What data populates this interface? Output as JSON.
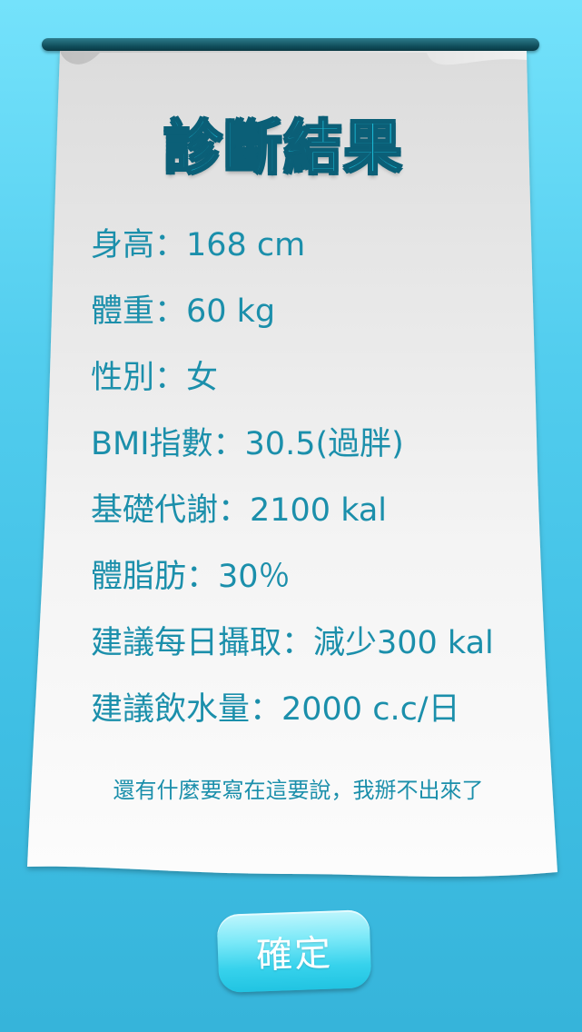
{
  "title": "診斷結果",
  "results": [
    "身高：168 cm",
    "體重：60 kg",
    "性別：女",
    "BMI指數：30.5(過胖)",
    "基礎代謝：2100 kal",
    "體脂肪：30％",
    "建議每日攝取：減少300 kal",
    "建議飲水量：2000 c.c/日"
  ],
  "note": "還有什麼要寫在這要說，我掰不出來了",
  "confirm_label": "確定",
  "colors": {
    "background_top": "#74e2fb",
    "background_bottom": "#36b4da",
    "text": "#1b8fab",
    "title_fill": "#1ab7d3",
    "title_outline": "#0b5f77",
    "button": "#37d2ec"
  }
}
